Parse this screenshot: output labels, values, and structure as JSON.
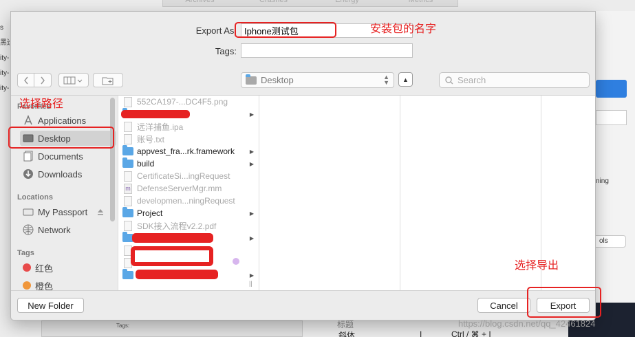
{
  "background": {
    "tabs": [
      "Archives",
      "Crashes",
      "Energy",
      "Metrics"
    ],
    "left_fragments": [
      "s",
      "黑送",
      "ity-",
      "ity-",
      "ity-"
    ],
    "right_text": "ning",
    "right_pill": "ols",
    "bottom_row": {
      "label": "斜体",
      "cursor": "I",
      "shortcut": "Ctrl / ⌘ + I",
      "above": "标题"
    },
    "bottom_tags": "Tags:"
  },
  "dialog": {
    "export_as_label": "Export As:",
    "export_as_value": "Iphone测试包",
    "tags_label": "Tags:",
    "tags_value": "",
    "location": "Desktop",
    "search_placeholder": "Search",
    "new_folder_label": "New Folder",
    "cancel_label": "Cancel",
    "export_label": "Export"
  },
  "sidebar": {
    "favorites_header": "Favorites",
    "favorites": [
      {
        "label": "Applications",
        "icon": "applications-icon"
      },
      {
        "label": "Desktop",
        "icon": "desktop-icon",
        "selected": true
      },
      {
        "label": "Documents",
        "icon": "documents-icon"
      },
      {
        "label": "Downloads",
        "icon": "downloads-icon"
      }
    ],
    "locations_header": "Locations",
    "locations": [
      {
        "label": "My Passport",
        "icon": "drive-icon",
        "eject": true
      },
      {
        "label": "Network",
        "icon": "network-icon"
      }
    ],
    "tags_header": "Tags",
    "tags": [
      {
        "label": "红色",
        "color": "#e84b4b"
      },
      {
        "label": "橙色",
        "color": "#f0963a"
      }
    ]
  },
  "files": [
    {
      "name": "552CA197-...DC4F5.png",
      "type": "doc",
      "dim": true
    },
    {
      "name": "",
      "type": "folder",
      "dim": false,
      "redacted": true,
      "arrow": true
    },
    {
      "name": "远洋捕鱼.ipa",
      "type": "doc",
      "dim": true
    },
    {
      "name": "账号.txt",
      "type": "doc",
      "dim": true
    },
    {
      "name": "appvest_fra...rk.framework",
      "type": "folder",
      "dim": false,
      "arrow": true
    },
    {
      "name": "build",
      "type": "folder",
      "dim": false,
      "arrow": true
    },
    {
      "name": "CertificateSi...ingRequest",
      "type": "doc",
      "dim": true
    },
    {
      "name": "DefenseServerMgr.mm",
      "type": "m",
      "dim": true
    },
    {
      "name": "developmen...ningRequest",
      "type": "doc",
      "dim": true
    },
    {
      "name": "Project",
      "type": "folder",
      "dim": false,
      "arrow": true
    },
    {
      "name": "SDK接入流程v2.2.pdf",
      "type": "doc",
      "dim": true
    },
    {
      "name": "",
      "type": "folder",
      "dim": false,
      "redacted": true,
      "arrow": true
    },
    {
      "name": "",
      "type": "doc",
      "dim": true,
      "redacted": true
    },
    {
      "name": "",
      "type": "doc",
      "dim": true,
      "redacted": true
    },
    {
      "name": "",
      "type": "folder",
      "dim": false,
      "redacted": true,
      "arrow": true
    }
  ],
  "annotations": {
    "name_note": "安装包的名字",
    "path_note": "选择路径",
    "export_note": "选择导出"
  },
  "watermark": "https://blog.csdn.net/qq_42461824",
  "colors": {
    "annotation_red": "#e62222",
    "folder_blue": "#5aa7e6"
  }
}
